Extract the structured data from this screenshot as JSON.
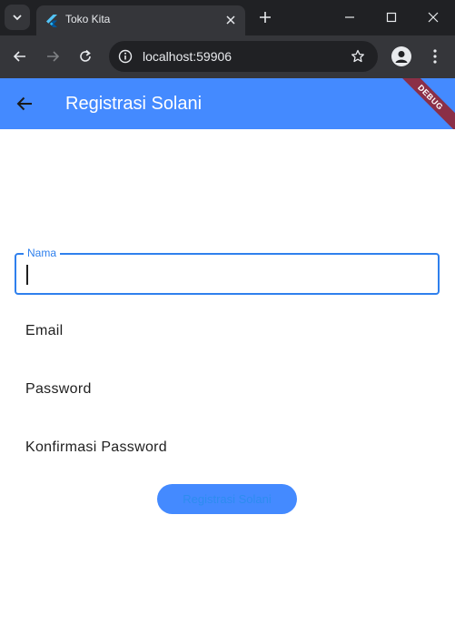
{
  "browser": {
    "tab": {
      "title": "Toko Kita"
    },
    "address": {
      "url": "localhost:59906"
    }
  },
  "app": {
    "appbar": {
      "title": "Registrasi Solani",
      "debug_banner": "DEBUG"
    },
    "form": {
      "nama_label": "Nama",
      "nama_value": "",
      "email_label": "Email",
      "password_label": "Password",
      "confirm_password_label": "Konfirmasi Password",
      "submit_label": "Registrasi Solani"
    }
  },
  "colors": {
    "primary": "#448aff",
    "focus": "#2f80ed",
    "debug_banner": "#8b2f47",
    "chrome_dark": "#202124",
    "chrome_toolbar": "#35363a"
  }
}
